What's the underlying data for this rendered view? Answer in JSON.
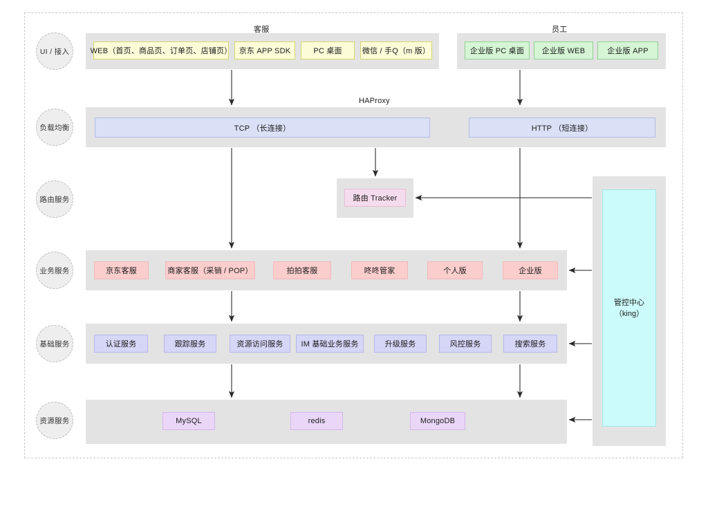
{
  "diagram": {
    "title_top_left_group": "客服",
    "title_top_right_group": "员工",
    "haproxy_label": "HAProxy",
    "colors": {
      "band": "#e3e3e3",
      "yellow": "#fcfcd9",
      "green": "#d5f5d5",
      "blue": "#dae0f5",
      "pink_light": "#f5dced",
      "pink": "#fbcdcd",
      "violet": "#d6d6f7",
      "purple": "#ead7f7",
      "cyan": "#ccfbfb",
      "frame_dash": "#c8c8c8",
      "arrow": "#404040"
    }
  },
  "layers": [
    {
      "label": "UI / 接入"
    },
    {
      "label": "负载均衡"
    },
    {
      "label": "路由服务"
    },
    {
      "label": "业务服务"
    },
    {
      "label": "基础服务"
    },
    {
      "label": "资源服务"
    }
  ],
  "ui_layer": {
    "customer_service": {
      "group_title": "客服",
      "nodes": [
        {
          "label": "WEB（首页、商品页、订单页、店铺页）"
        },
        {
          "label": "京东 APP SDK"
        },
        {
          "label": "PC 桌面"
        },
        {
          "label": "微信 / 手Q（m 版）"
        }
      ]
    },
    "staff": {
      "group_title": "员工",
      "nodes": [
        {
          "label": "企业版 PC 桌面"
        },
        {
          "label": "企业版 WEB"
        },
        {
          "label": "企业版 APP"
        }
      ]
    }
  },
  "load_balance_layer": {
    "label": "HAProxy",
    "nodes": [
      {
        "label": "TCP （长连接）"
      },
      {
        "label": "HTTP （短连接）"
      }
    ]
  },
  "route_layer": {
    "nodes": [
      {
        "label": "路由 Tracker"
      }
    ]
  },
  "business_layer": {
    "nodes": [
      {
        "label": "京东客服"
      },
      {
        "label": "商家客服（采销 / POP）"
      },
      {
        "label": "拍拍客服"
      },
      {
        "label": "咚咚管家"
      },
      {
        "label": "个人版"
      },
      {
        "label": "企业版"
      }
    ]
  },
  "basic_layer": {
    "nodes": [
      {
        "label": "认证服务"
      },
      {
        "label": "跟踪服务"
      },
      {
        "label": "资源访问服务"
      },
      {
        "label": "IM 基础业务服务"
      },
      {
        "label": "升级服务"
      },
      {
        "label": "风控服务"
      },
      {
        "label": "搜索服务"
      }
    ]
  },
  "resource_layer": {
    "nodes": [
      {
        "label": "MySQL"
      },
      {
        "label": "redis"
      },
      {
        "label": "MongoDB"
      }
    ]
  },
  "management_center": {
    "line1": "管控中心",
    "line2": "（king）"
  }
}
